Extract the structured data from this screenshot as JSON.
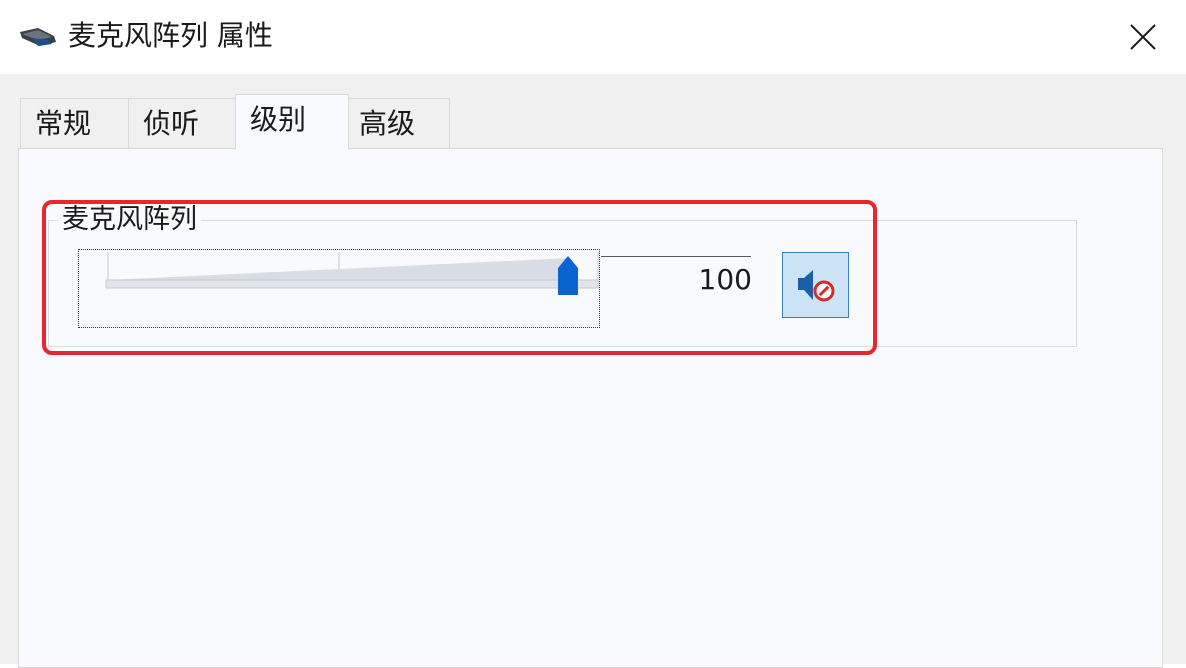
{
  "window": {
    "title": "麦克风阵列 属性"
  },
  "tabs": [
    {
      "label": "常规",
      "active": false
    },
    {
      "label": "侦听",
      "active": false
    },
    {
      "label": "级别",
      "active": true
    },
    {
      "label": "高级",
      "active": false
    }
  ],
  "levels": {
    "group_label": "麦克风阵列",
    "value": "100",
    "slider_level_percent": 100,
    "mute_icon": "speaker-muted-icon"
  },
  "colors": {
    "highlight": "#e8262b",
    "slider_thumb": "#0a64d2",
    "mute_button_bg": "#cde4f7"
  },
  "icons": {
    "app": "microphone-array-icon",
    "close": "close-icon"
  }
}
